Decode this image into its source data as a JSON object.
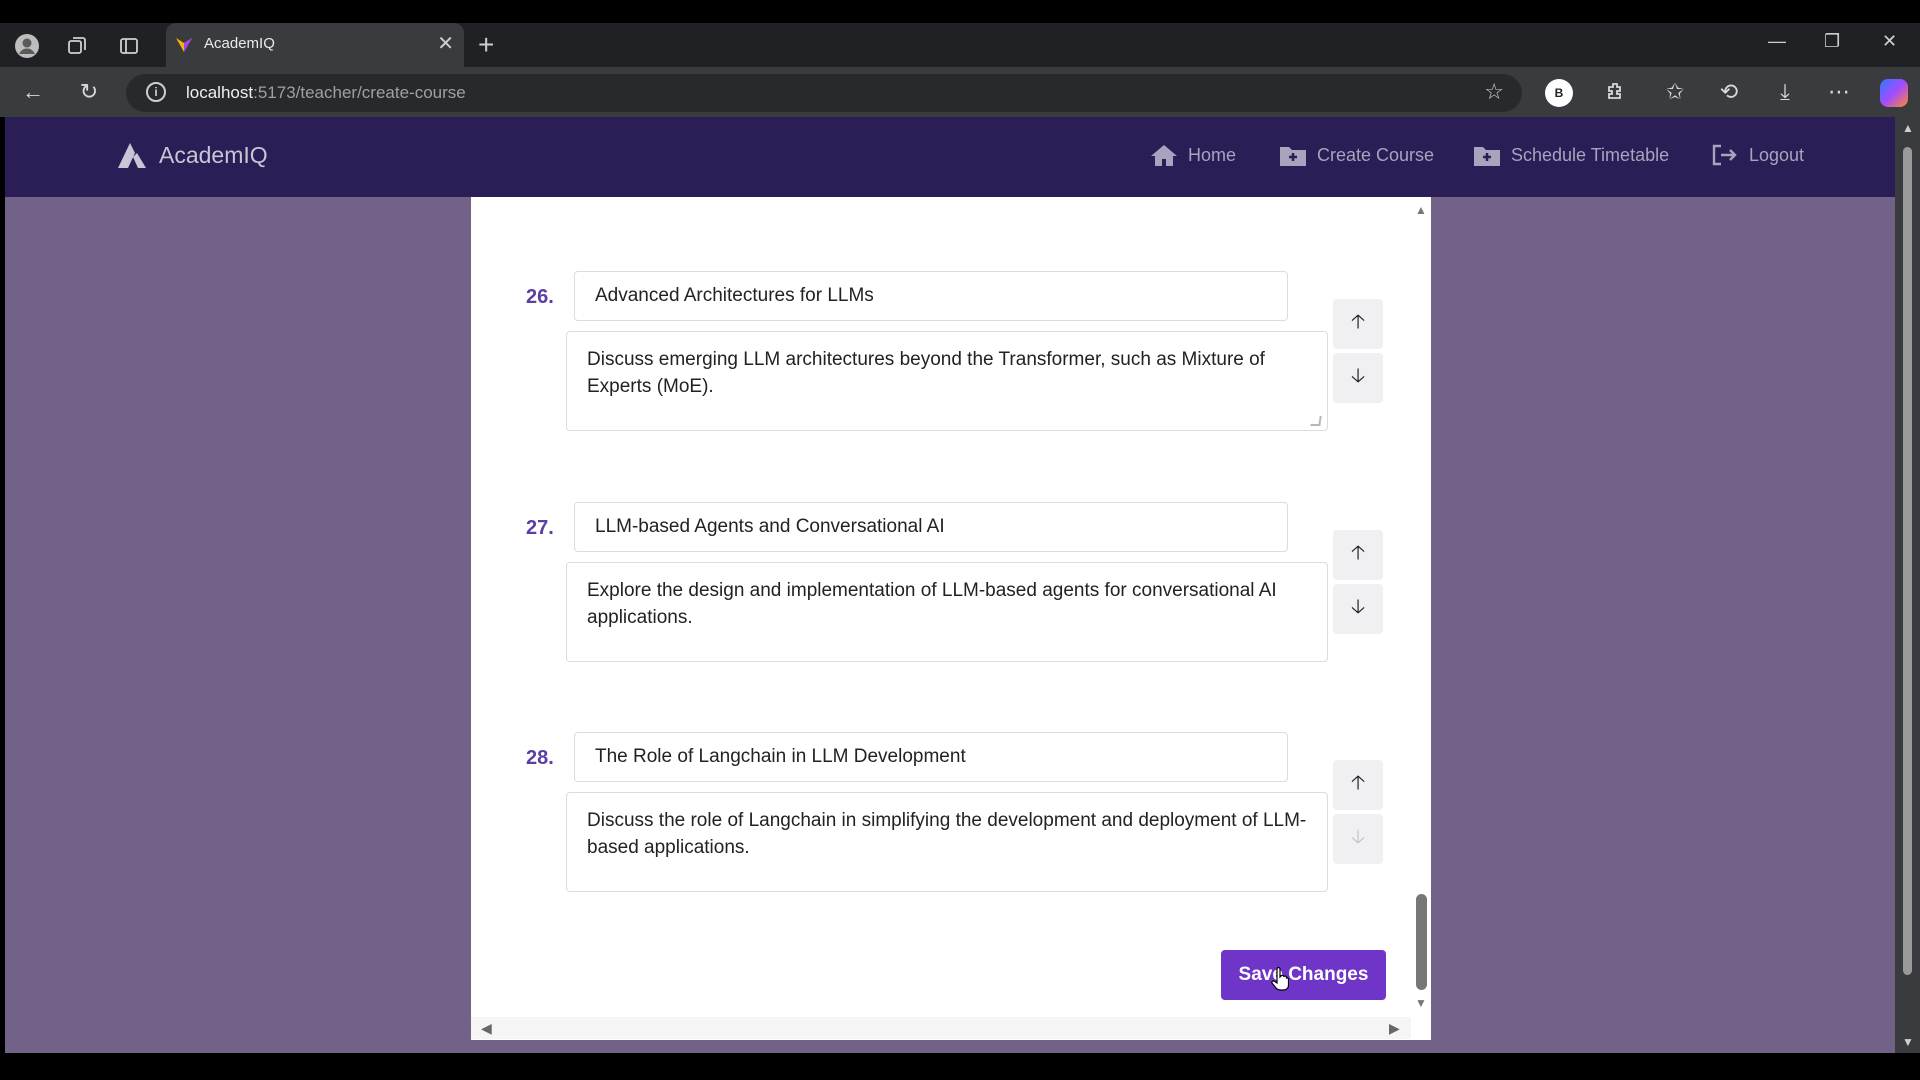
{
  "browser": {
    "tab_title": "AcademIQ",
    "url_host": "localhost",
    "url_path": ":5173/teacher/create-course",
    "profile_initial": "B"
  },
  "navbar": {
    "brand": "AcademIQ",
    "items": [
      {
        "label": "Home",
        "icon": "home-icon"
      },
      {
        "label": "Create Course",
        "icon": "folder-plus-icon"
      },
      {
        "label": "Schedule Timetable",
        "icon": "folder-plus-icon"
      },
      {
        "label": "Logout",
        "icon": "logout-icon"
      }
    ]
  },
  "topics": [
    {
      "number": "26.",
      "title": "Advanced Architectures for LLMs",
      "description": "Discuss emerging LLM architectures beyond the Transformer, such as Mixture of Experts (MoE)."
    },
    {
      "number": "27.",
      "title": "LLM-based Agents and Conversational AI",
      "description": "Explore the design and implementation of LLM-based agents for conversational AI applications."
    },
    {
      "number": "28.",
      "title": "The Role of Langchain in LLM Development",
      "description": "Discuss the role of Langchain in simplifying the development and deployment of LLM-based applications."
    }
  ],
  "save_label": "Save Changes",
  "colors": {
    "accent": "#6f35c9",
    "navbar": "#2b1d55",
    "page_bg": "#736287",
    "number": "#5a3ea3"
  }
}
